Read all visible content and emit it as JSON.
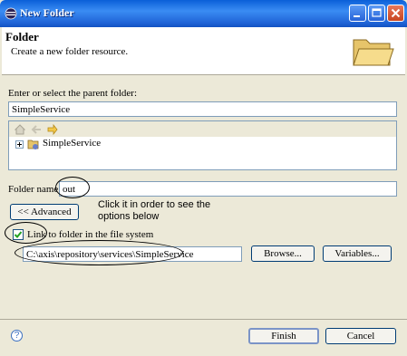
{
  "window": {
    "title": "New Folder"
  },
  "header": {
    "title": "Folder",
    "description": "Create a new folder resource."
  },
  "parent": {
    "label": "Enter or select the parent folder:",
    "value": "SimpleService",
    "tree_item": "SimpleService"
  },
  "folder_name": {
    "label": "Folder name:",
    "value": "out"
  },
  "advanced": {
    "label": "<< Advanced"
  },
  "annotation": {
    "line1": "Click it in order to see the",
    "line2": "options below"
  },
  "link": {
    "checkbox_label": "Link to folder in the file system",
    "checked": true,
    "path": "C:\\axis\\repository\\services\\SimpleService",
    "browse_label": "Browse...",
    "variables_label": "Variables..."
  },
  "footer": {
    "finish_label": "Finish",
    "cancel_label": "Cancel",
    "help_glyph": "?"
  }
}
